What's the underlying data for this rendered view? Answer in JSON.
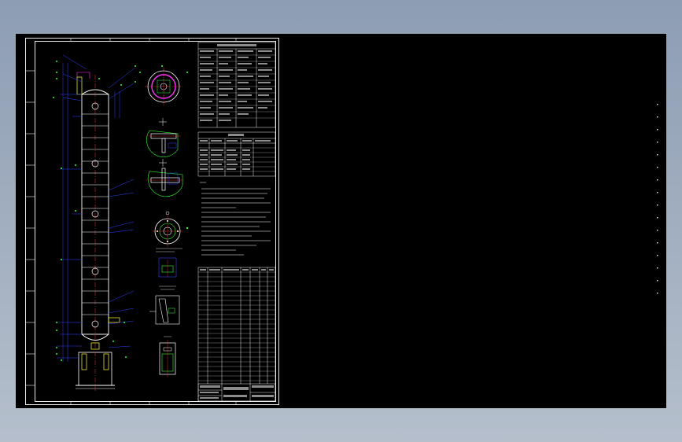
{
  "window": {
    "background_top": "#8d9db3",
    "background_bottom": "#b5bfcc"
  },
  "viewport": {
    "background": "#000000"
  },
  "colors": {
    "frame_line": "#e8e8e8",
    "outline": "#ffffff",
    "dimension": "#3040ff",
    "center_line": "#ff3030",
    "section": "#ff33ff",
    "detail": "#33ff33",
    "nozzle": "#ffff33",
    "text": "#ffffff"
  },
  "drawing": {
    "type": "vessel-assembly",
    "views": [
      "column-elevation",
      "top-section",
      "detail-a",
      "detail-b",
      "detail-c",
      "detail-d",
      "detail-e",
      "detail-f"
    ],
    "icons": [
      "zoom-icon",
      "pan-icon"
    ]
  }
}
